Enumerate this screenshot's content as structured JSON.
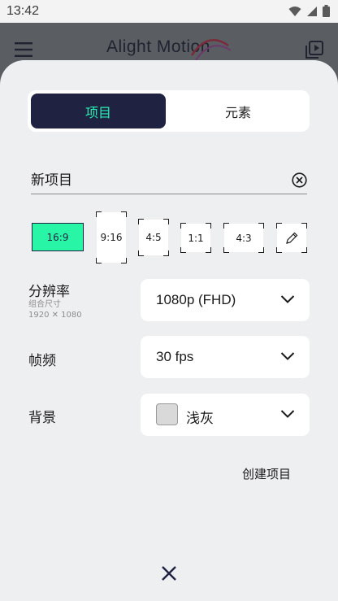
{
  "status_bar": {
    "time": "13:42"
  },
  "app_bar": {
    "title": "Alight Motion"
  },
  "tabs": {
    "active_label": "项目",
    "inactive_label": "元素"
  },
  "project_name": {
    "value": "新项目"
  },
  "aspect_ratios": [
    "16:9",
    "9:16",
    "4:5",
    "1:1",
    "4:3"
  ],
  "selected_ratio": "16:9",
  "resolution": {
    "label": "分辨率",
    "sub1": "组合尺寸",
    "sub2": "1920 ✕ 1080",
    "value": "1080p (FHD)"
  },
  "frame_rate": {
    "label": "帧频",
    "value": "30 fps"
  },
  "background": {
    "label": "背景",
    "value": "浅灰",
    "color": "#d9d9d9"
  },
  "actions": {
    "create_label": "创建项目"
  },
  "colors": {
    "accent": "#28f5a6",
    "dark": "#1f2240",
    "sheet": "#eeeff1"
  }
}
